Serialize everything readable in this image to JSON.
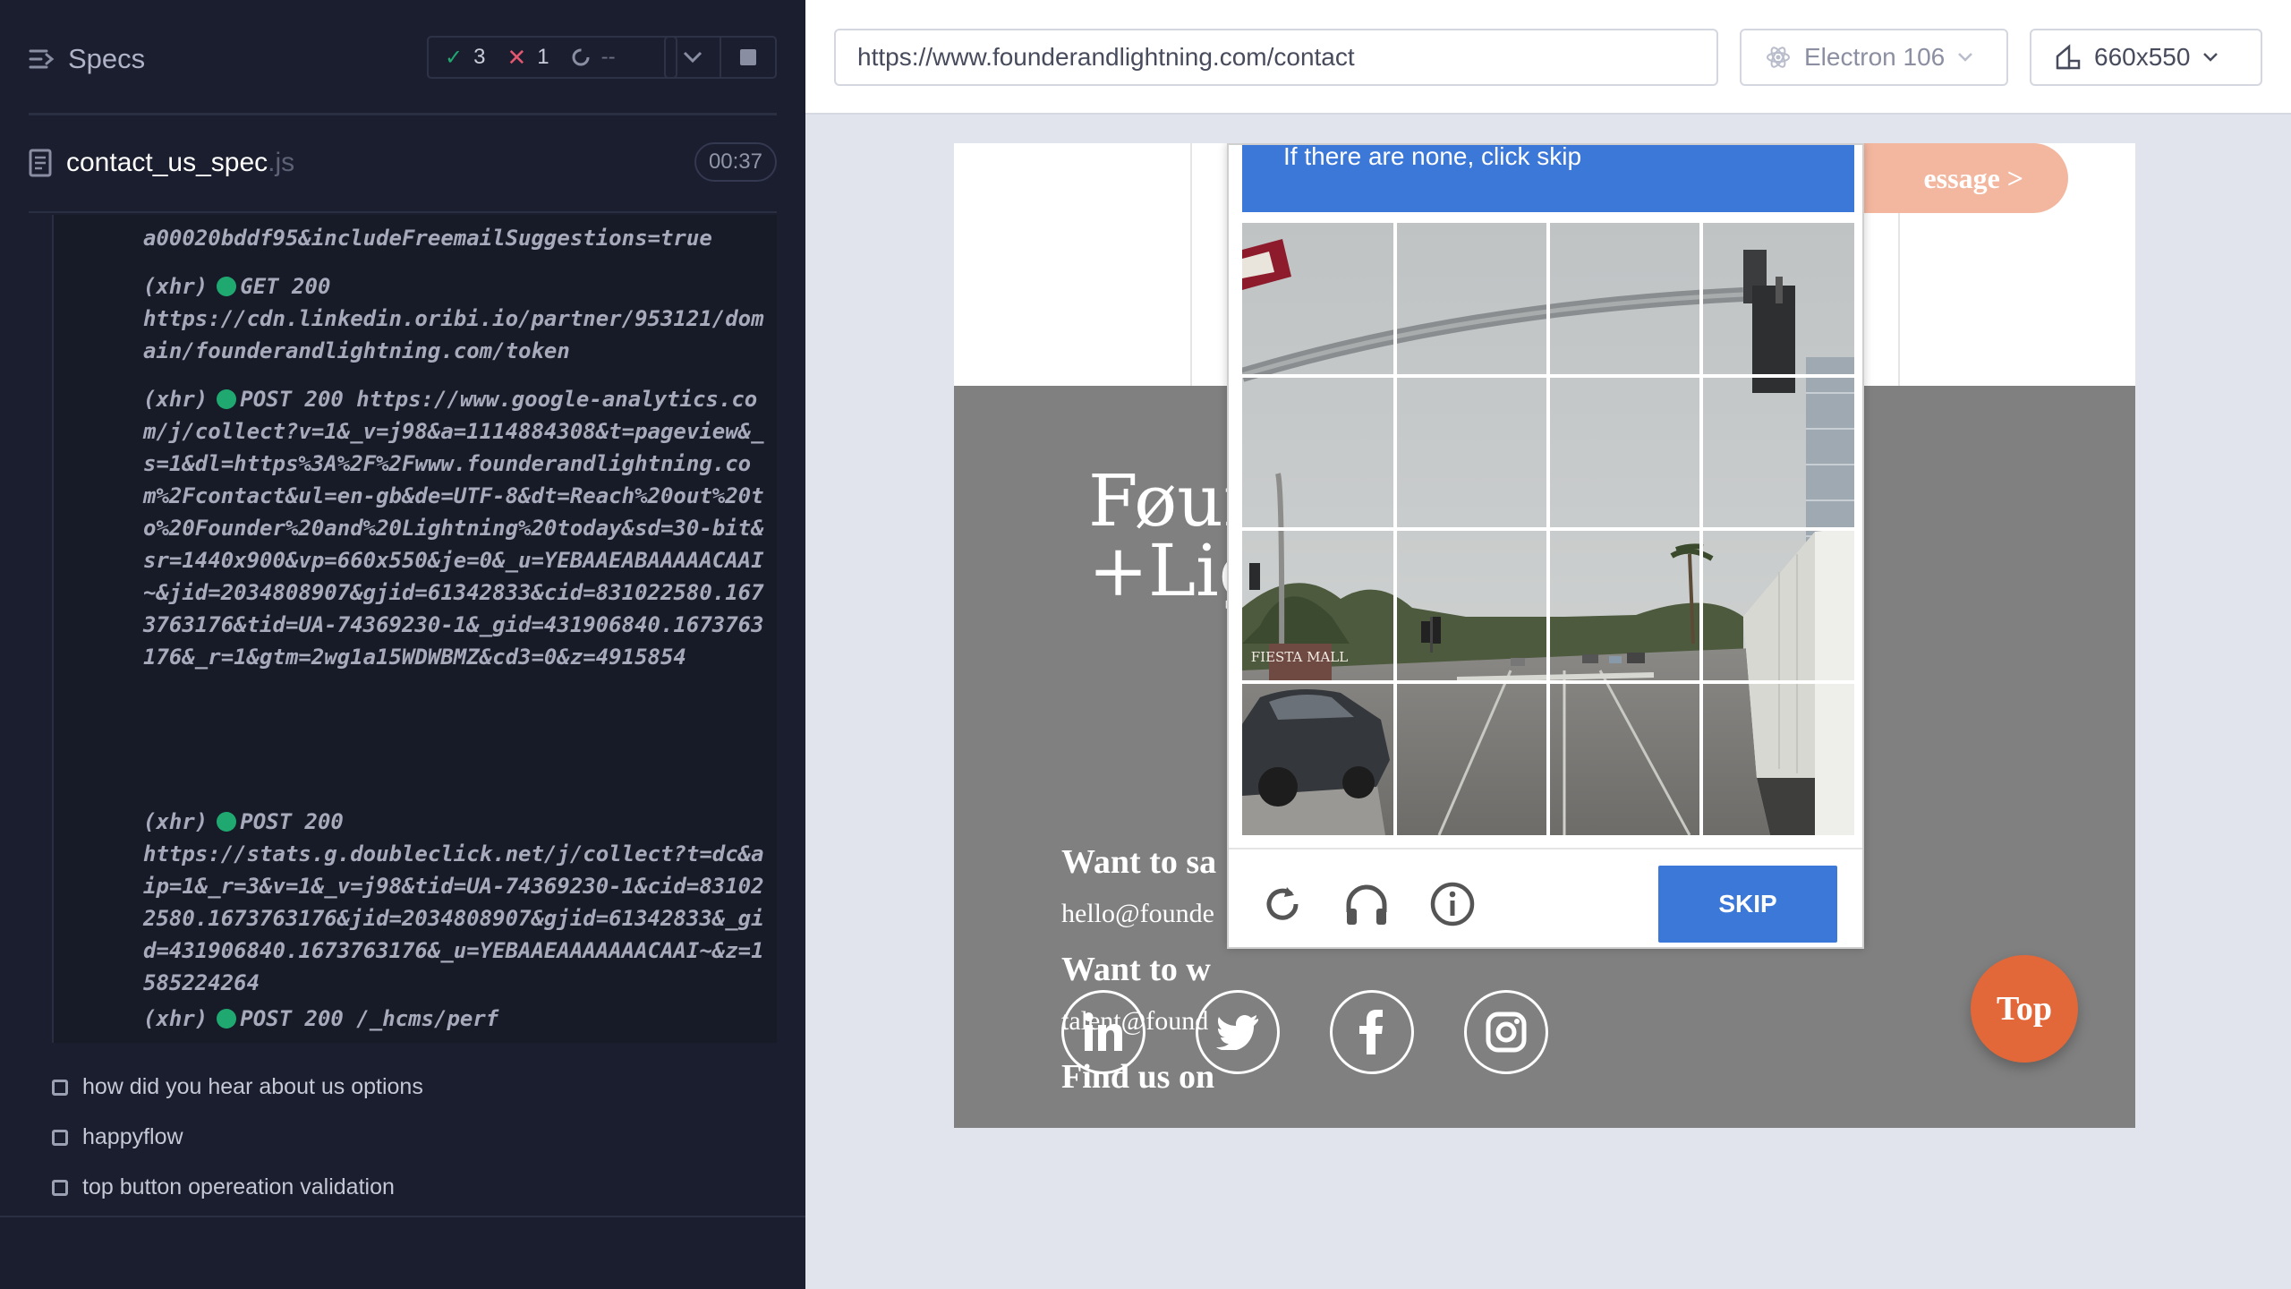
{
  "reporter": {
    "title": "Specs",
    "stats": {
      "passed": "3",
      "failed": "1",
      "pending": "--"
    },
    "spec": {
      "name": "contact_us_spec",
      "ext": ".js",
      "duration": "00:37"
    },
    "log": [
      {
        "prefix": "",
        "status": "",
        "text": "a00020bddf95&includeFreemailSuggestions=true"
      },
      {
        "prefix": "(xhr)",
        "status": "GET 200",
        "text": "https://cdn.linkedin.oribi.io/partner/953121/domain/founderandlightning.com/token"
      },
      {
        "prefix": "(xhr)",
        "status": "POST 200",
        "text": "https://www.google-analytics.com/j/collect?v=1&_v=j98&a=1114884308&t=pageview&_s=1&dl=https%3A%2F%2Fwww.founderandlightning.com%2Fcontact&ul=en-gb&de=UTF-8&dt=Reach%20out%20to%20Founder%20and%20Lightning%20today&sd=30-bit&sr=1440x900&vp=660x550&je=0&_u=YEBAAEABAAAAACAAI~&jid=2034808907&gjid=61342833&cid=831022580.1673763176&tid=UA-74369230-1&_gid=431906840.1673763176&_r=1&gtm=2wg1a15WDWBMZ&cd3=0&z=4915854"
      },
      {
        "prefix": "(xhr)",
        "status": "POST 200",
        "text": "https://stats.g.doubleclick.net/j/collect?t=dc&aip=1&_r=3&v=1&_v=j98&tid=UA-74369230-1&cid=831022580.1673763176&jid=2034808907&gjid=61342833&_gid=431906840.1673763176&_u=YEBAAEAAAAAAACAAI~&z=1585224264"
      },
      {
        "prefix": "(xhr)",
        "status": "POST 200",
        "text": "/_hcms/perf"
      }
    ],
    "tests": [
      "how did you hear about us options",
      "happyflow",
      "top button opereation validation"
    ]
  },
  "topbar": {
    "url": "https://www.founderandlightning.com/contact",
    "browser": "Electron 106",
    "viewport": "660x550"
  },
  "page": {
    "send_button": "essage >",
    "logo_line1": "Føun",
    "logo_line2": "+Lig",
    "sales_heading": "Want to sa",
    "sales_email": "hello@founde",
    "work_heading": "Want to w",
    "work_email": "talent@found",
    "find_heading": "Find us on",
    "top_button": "Top"
  },
  "captcha": {
    "banner": "If there are none, click skip",
    "skip": "SKIP",
    "sign_text": "FIESTA MALL",
    "accent": "#3c78d8"
  },
  "colors": {
    "reporter_bg": "#1b1e2e",
    "pass": "#1fa971",
    "fail": "#e45770",
    "footer_gray": "#808080",
    "top_button": "#e2683a"
  }
}
